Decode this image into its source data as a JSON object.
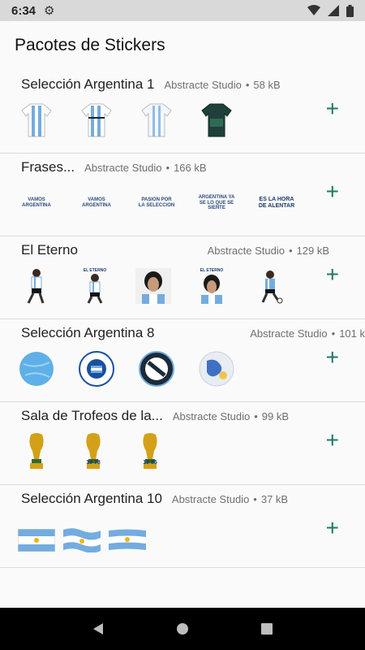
{
  "status_bar": {
    "time": "6:34"
  },
  "app_title": "Pacotes de Stickers",
  "packs": [
    {
      "name": "Selección Argentina 1",
      "author": "Abstracte Studio",
      "size": "58 kB"
    },
    {
      "name": "Frases...",
      "author": "Abstracte Studio",
      "size": "166 kB"
    },
    {
      "name": "El Eterno",
      "author": "Abstracte Studio",
      "size": "129 kB"
    },
    {
      "name": "Selección Argentina 8",
      "author": "Abstracte Studio",
      "size": "101 k"
    },
    {
      "name": "Sala de Trofeos de la...",
      "author": "Abstracte Studio",
      "size": "99 kB"
    },
    {
      "name": "Selección Argentina 10",
      "author": "Abstracte Studio",
      "size": "37 kB"
    }
  ],
  "frases_stickers": [
    "VAMOS ARGENTINA",
    "VAMOS ARGENTINA",
    "PASION POR LA SELECCION",
    "ARGENTINA YA SE LO QUE SE SIENTE",
    "ES LA HORA DE ALENTAR"
  ],
  "el_eterno_labels": [
    "EL ETERNO",
    "EL ETERNO"
  ],
  "trophy_years": [
    "19 78",
    "19 86"
  ],
  "add_label": "+",
  "colors": {
    "accent": "#1f7a64",
    "sky_blue": "#74acdf",
    "gold": "#d4a017"
  }
}
